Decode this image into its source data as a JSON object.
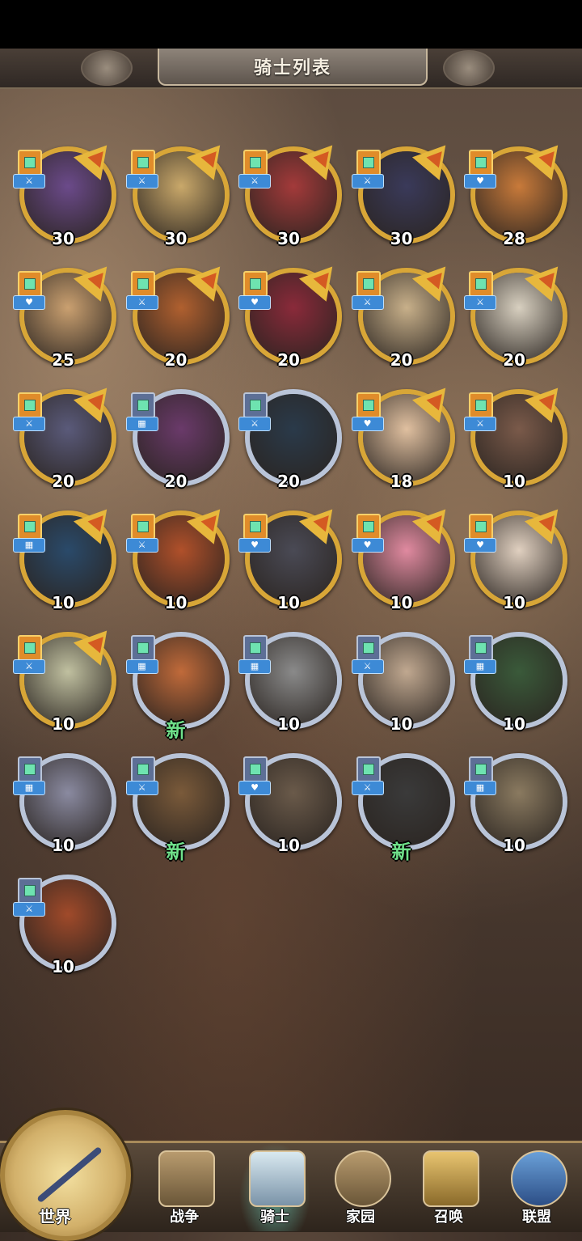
{
  "header": {
    "title": "骑士列表"
  },
  "knights": [
    {
      "level": "30",
      "frame": "gold",
      "role": "⚔"
    },
    {
      "level": "30",
      "frame": "gold",
      "role": "⚔"
    },
    {
      "level": "30",
      "frame": "gold",
      "role": "⚔"
    },
    {
      "level": "30",
      "frame": "gold",
      "role": "⚔"
    },
    {
      "level": "28",
      "frame": "gold",
      "role": "♥"
    },
    {
      "level": "25",
      "frame": "gold",
      "role": "♥"
    },
    {
      "level": "20",
      "frame": "gold",
      "role": "⚔"
    },
    {
      "level": "20",
      "frame": "gold",
      "role": "♥"
    },
    {
      "level": "20",
      "frame": "gold",
      "role": "⚔"
    },
    {
      "level": "20",
      "frame": "gold",
      "role": "⚔"
    },
    {
      "level": "20",
      "frame": "gold",
      "role": "⚔"
    },
    {
      "level": "20",
      "frame": "silver",
      "role": "▦"
    },
    {
      "level": "20",
      "frame": "silver",
      "role": "⚔"
    },
    {
      "level": "18",
      "frame": "gold",
      "role": "♥"
    },
    {
      "level": "10",
      "frame": "gold",
      "role": "⚔"
    },
    {
      "level": "10",
      "frame": "gold",
      "role": "▦"
    },
    {
      "level": "10",
      "frame": "gold",
      "role": "⚔"
    },
    {
      "level": "10",
      "frame": "gold",
      "role": "♥"
    },
    {
      "level": "10",
      "frame": "gold",
      "role": "♥"
    },
    {
      "level": "10",
      "frame": "gold",
      "role": "♥"
    },
    {
      "level": "10",
      "frame": "gold",
      "role": "⚔"
    },
    {
      "level": "新",
      "frame": "silver",
      "role": "▦"
    },
    {
      "level": "10",
      "frame": "silver",
      "role": "▦"
    },
    {
      "level": "10",
      "frame": "silver",
      "role": "⚔"
    },
    {
      "level": "10",
      "frame": "silver",
      "role": "▦"
    },
    {
      "level": "10",
      "frame": "silver",
      "role": "▦"
    },
    {
      "level": "新",
      "frame": "silver",
      "role": "⚔"
    },
    {
      "level": "10",
      "frame": "silver",
      "role": "♥"
    },
    {
      "level": "新",
      "frame": "silver",
      "role": "⚔"
    },
    {
      "level": "10",
      "frame": "silver",
      "role": "▦"
    },
    {
      "level": "10",
      "frame": "silver",
      "role": "⚔"
    }
  ],
  "nav": {
    "world": "世界",
    "items": [
      {
        "label": "战争",
        "active": false
      },
      {
        "label": "骑士",
        "active": true
      },
      {
        "label": "家园",
        "active": false
      },
      {
        "label": "召唤",
        "active": false
      },
      {
        "label": "联盟",
        "active": false
      }
    ]
  },
  "colors": {
    "gold_frame": "#d8a637",
    "silver_frame": "#b9c4d8",
    "new_text": "#6fe08a"
  }
}
